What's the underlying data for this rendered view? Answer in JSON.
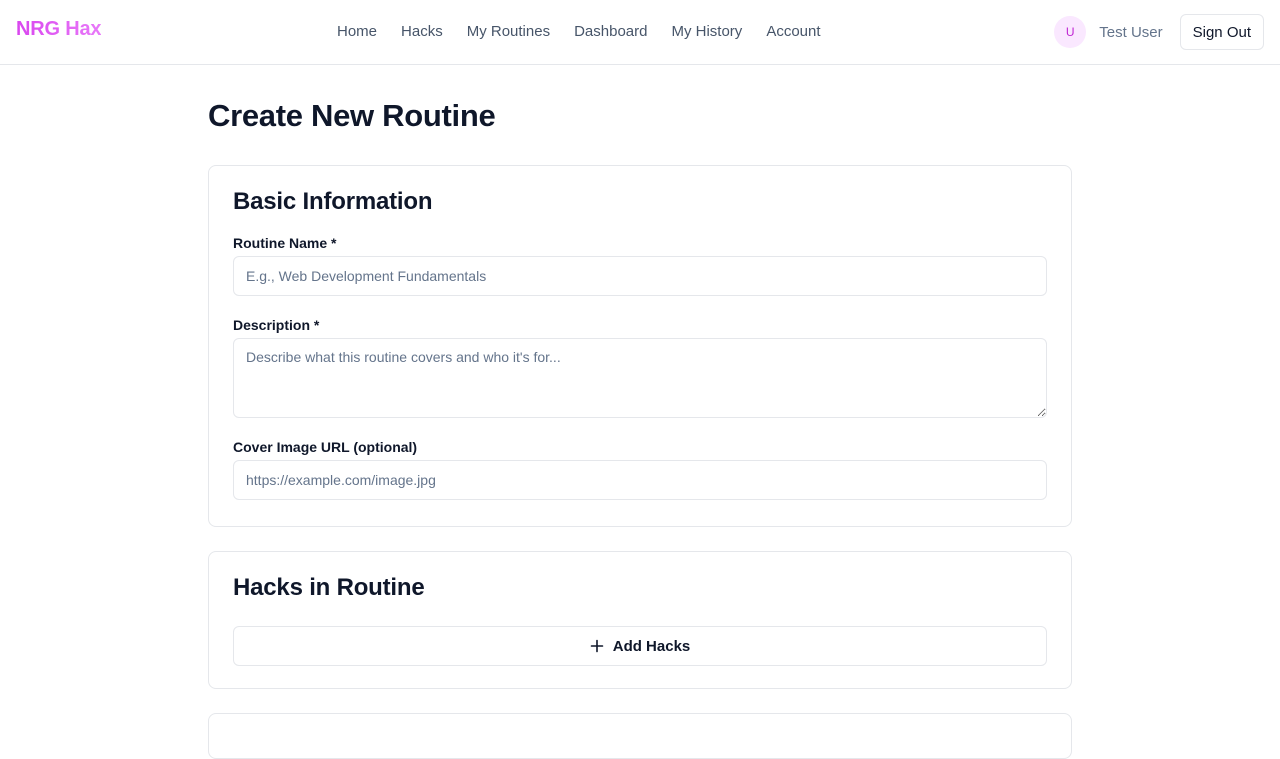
{
  "header": {
    "brand": "NRG Hax",
    "nav": [
      "Home",
      "Hacks",
      "My Routines",
      "Dashboard",
      "My History",
      "Account"
    ],
    "user": {
      "avatar_initial": "U",
      "name": "Test User",
      "sign_out_label": "Sign Out"
    }
  },
  "page": {
    "title": "Create New Routine"
  },
  "basic_info": {
    "title": "Basic Information",
    "routine_name": {
      "label": "Routine Name *",
      "placeholder": "E.g., Web Development Fundamentals",
      "value": ""
    },
    "description": {
      "label": "Description *",
      "placeholder": "Describe what this routine covers and who it's for...",
      "value": ""
    },
    "cover_image": {
      "label": "Cover Image URL (optional)",
      "placeholder": "https://example.com/image.jpg",
      "value": ""
    }
  },
  "hacks_section": {
    "title": "Hacks in Routine",
    "add_button_label": "Add Hacks",
    "add_button_icon": "plus-icon"
  },
  "colors": {
    "brand_gradient_start": "#d946ef",
    "brand_gradient_end": "#e879f9",
    "avatar_bg": "#fae8ff",
    "avatar_fg": "#c026d3",
    "border": "#e5e7eb"
  }
}
